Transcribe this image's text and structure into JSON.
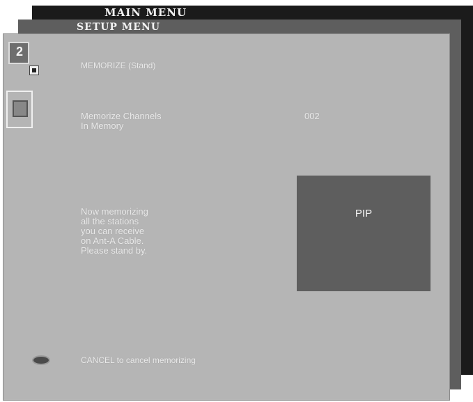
{
  "menus": {
    "main_title": "MAIN MENU",
    "setup_title": "SETUP MENU"
  },
  "icons": {
    "memo_number": "2"
  },
  "content": {
    "section_title": "MEMORIZE (Stand)",
    "memorize_label": "Memorize Channels",
    "in_memory_label": "In Memory",
    "channel_count": "002",
    "message_lines": [
      "Now memorizing",
      "all the stations",
      "you can receive",
      "on Ant-A Cable.",
      "Please stand by."
    ],
    "pip_label": "PIP",
    "cancel_hint": "CANCEL to cancel memorizing"
  },
  "colors": {
    "back_panel": "#1b1b1b",
    "middle_panel": "#5e5e5e",
    "front_panel": "#b5b5b5",
    "text": "#eaeaea",
    "pip_window": "#5e5e5e"
  }
}
